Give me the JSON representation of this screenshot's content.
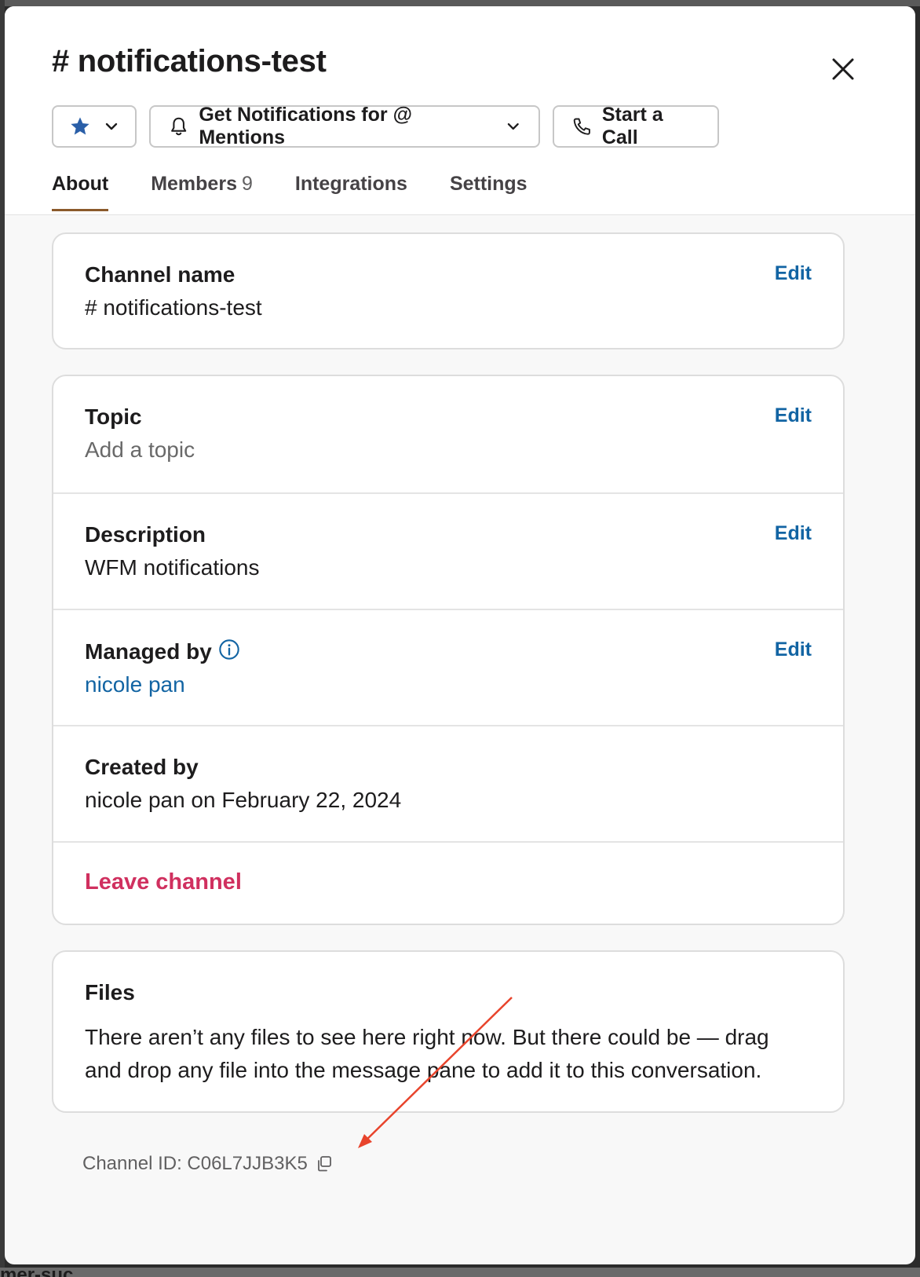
{
  "background": {
    "channel_fragment": "mer-suc..."
  },
  "modal": {
    "title": "# notifications-test",
    "buttons": {
      "notifications_label": "Get Notifications for @ Mentions",
      "call_label": "Start a Call"
    },
    "tabs": [
      {
        "label": "About",
        "active": true
      },
      {
        "label": "Members",
        "count": "9"
      },
      {
        "label": "Integrations"
      },
      {
        "label": "Settings"
      }
    ],
    "channel_name": {
      "label": "Channel name",
      "value": "# notifications-test",
      "edit": "Edit"
    },
    "topic": {
      "label": "Topic",
      "value": "Add a topic",
      "edit": "Edit"
    },
    "description": {
      "label": "Description",
      "value": "WFM notifications",
      "edit": "Edit"
    },
    "managed_by": {
      "label": "Managed by",
      "value": "nicole pan",
      "edit": "Edit"
    },
    "created_by": {
      "label": "Created by",
      "value": "nicole pan on February 22, 2024"
    },
    "leave_channel": "Leave channel",
    "files": {
      "label": "Files",
      "body": "There aren’t any files to see here right now. But there could be — drag and drop any file into the message pane to add it to this conversation."
    },
    "channel_id": "Channel ID: C06L7JJB3K5"
  },
  "colors": {
    "link": "#1264a3",
    "danger": "#d0305f",
    "active_tab_underline": "#8b5a2b",
    "annotation_arrow": "#e8442c",
    "star": "#2a5fa8"
  },
  "icons": [
    "star-icon",
    "chevron-down-icon",
    "bell-icon",
    "phone-icon",
    "close-icon",
    "info-icon",
    "copy-icon"
  ]
}
